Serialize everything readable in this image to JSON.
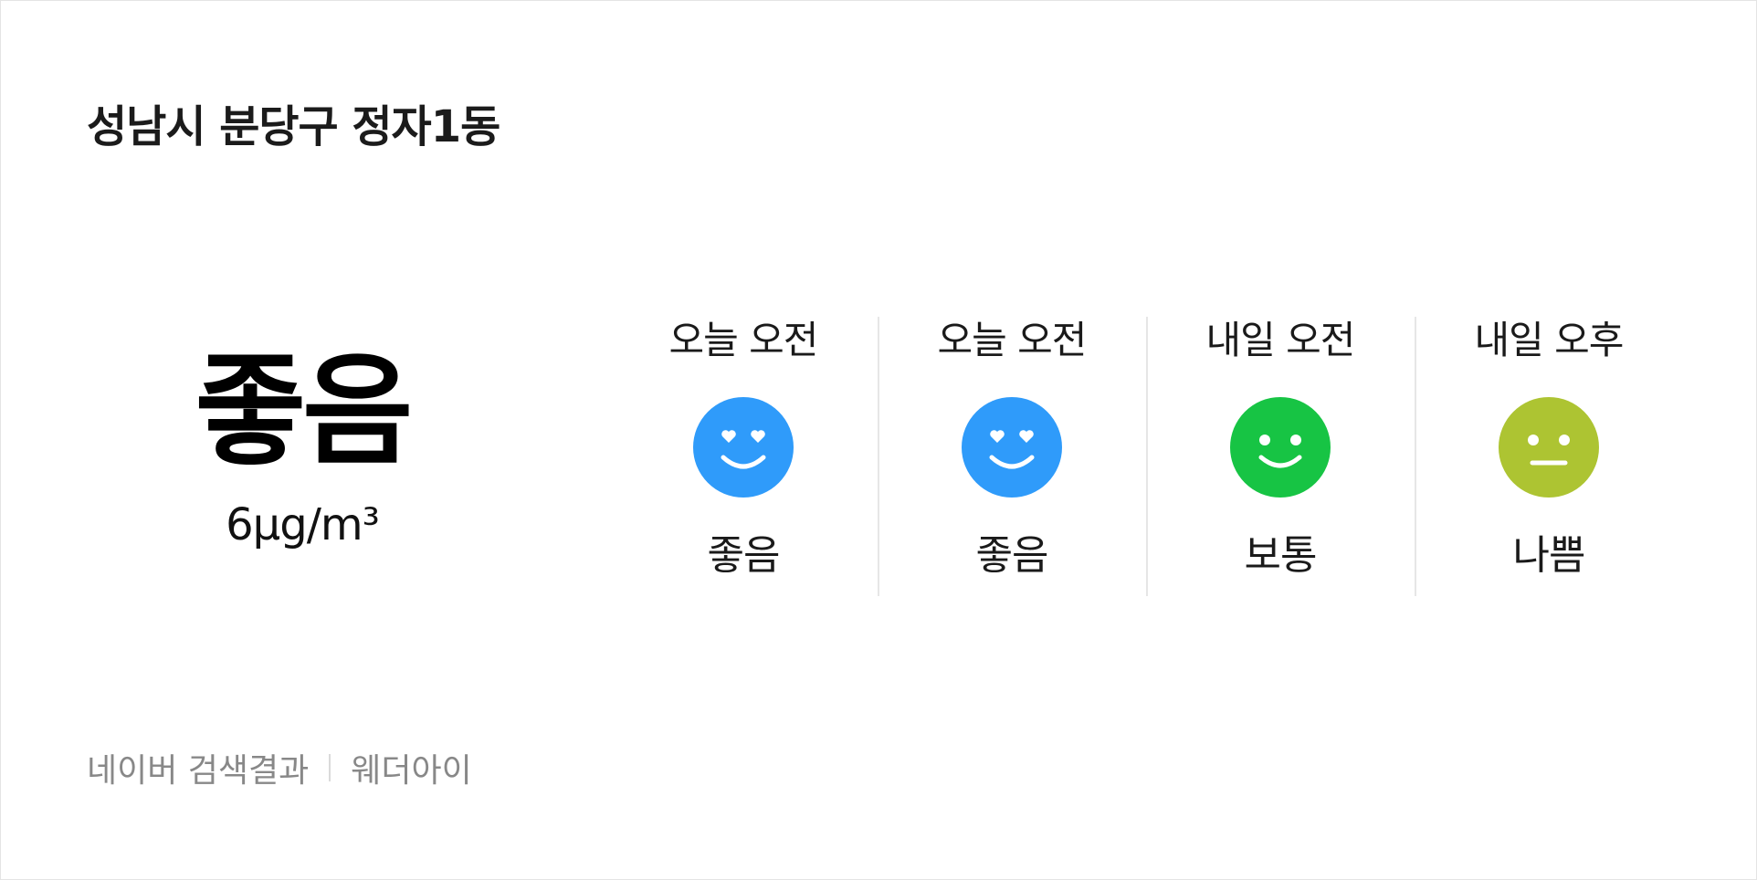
{
  "location": "성남시 분당구 정자1동",
  "current": {
    "grade": "좋음",
    "value": "6μg/m³"
  },
  "forecast": [
    {
      "label": "오늘 오전",
      "grade": "좋음",
      "icon": "heart-eyes-smile-icon",
      "color": "#2F9BFA"
    },
    {
      "label": "오늘 오전",
      "grade": "좋음",
      "icon": "heart-eyes-smile-icon",
      "color": "#2F9BFA"
    },
    {
      "label": "내일 오전",
      "grade": "보통",
      "icon": "smile-face-icon",
      "color": "#17C444"
    },
    {
      "label": "내일 오후",
      "grade": "나쁨",
      "icon": "neutral-face-icon",
      "color": "#ADC432"
    }
  ],
  "footer": {
    "source": "네이버 검색결과",
    "brand": "웨더아이"
  }
}
